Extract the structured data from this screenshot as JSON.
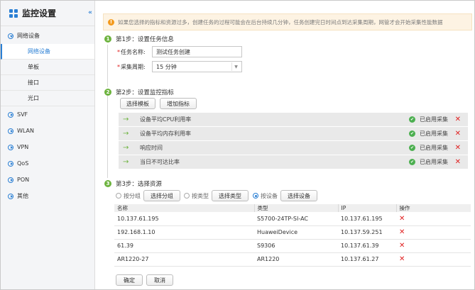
{
  "sidebar": {
    "title": "监控设置",
    "collapse_icon": "«",
    "groups": [
      {
        "label": "网络设备",
        "expanded": true
      },
      {
        "label": "SVF"
      },
      {
        "label": "WLAN"
      },
      {
        "label": "VPN"
      },
      {
        "label": "QoS"
      },
      {
        "label": "PON"
      },
      {
        "label": "其他"
      }
    ],
    "sub_items": [
      "网络设备",
      "单板",
      "接口",
      "光口"
    ]
  },
  "tip": {
    "text": "如果您选择的指标和资源过多，创建任务的过程可能会在后台持续几分钟，任务创建完日时间点到达采集周期，网管才会开始采集性能数据"
  },
  "step1": {
    "num": "1",
    "title": "第1步：设置任务信息",
    "task_name_label": "任务名称:",
    "task_name_value": "测试任务创建",
    "period_label": "采集周期:",
    "period_value": "15 分钟",
    "required_mark": "*"
  },
  "step2": {
    "num": "2",
    "title": "第2步：设置监控指标",
    "btn_template": "选择模板",
    "btn_add": "增加指标",
    "metrics": [
      {
        "name": "设备平均CPU利用率",
        "status": "已启用采集"
      },
      {
        "name": "设备平均内存利用率",
        "status": "已启用采集"
      },
      {
        "name": "响应时间",
        "status": "已启用采集"
      },
      {
        "name": "当日不可达比率",
        "status": "已启用采集"
      }
    ]
  },
  "step3": {
    "num": "3",
    "title": "第3步：选择资源",
    "opt_group": "按分组",
    "btn_group": "选择分组",
    "opt_type": "按类型",
    "btn_type": "选择类型",
    "opt_device": "按设备",
    "btn_device": "选择设备",
    "selected": "按设备"
  },
  "table": {
    "headers": [
      "名称",
      "类型",
      "IP",
      "操作"
    ],
    "rows": [
      {
        "name": "10.137.61.195",
        "type": "S5700-24TP-SI-AC",
        "ip": "10.137.61.195"
      },
      {
        "name": "192.168.1.10",
        "type": "HuaweiDevice",
        "ip": "10.137.59.251"
      },
      {
        "name": "61.39",
        "type": "S9306",
        "ip": "10.137.61.39"
      },
      {
        "name": "AR1220-27",
        "type": "AR1220",
        "ip": "10.137.61.27"
      }
    ]
  },
  "footer": {
    "ok": "确定",
    "cancel": "取消"
  },
  "colors": {
    "accent": "#2a7fd4",
    "step": "#6db33f",
    "danger": "#e02020",
    "warn": "#f39a1e"
  }
}
